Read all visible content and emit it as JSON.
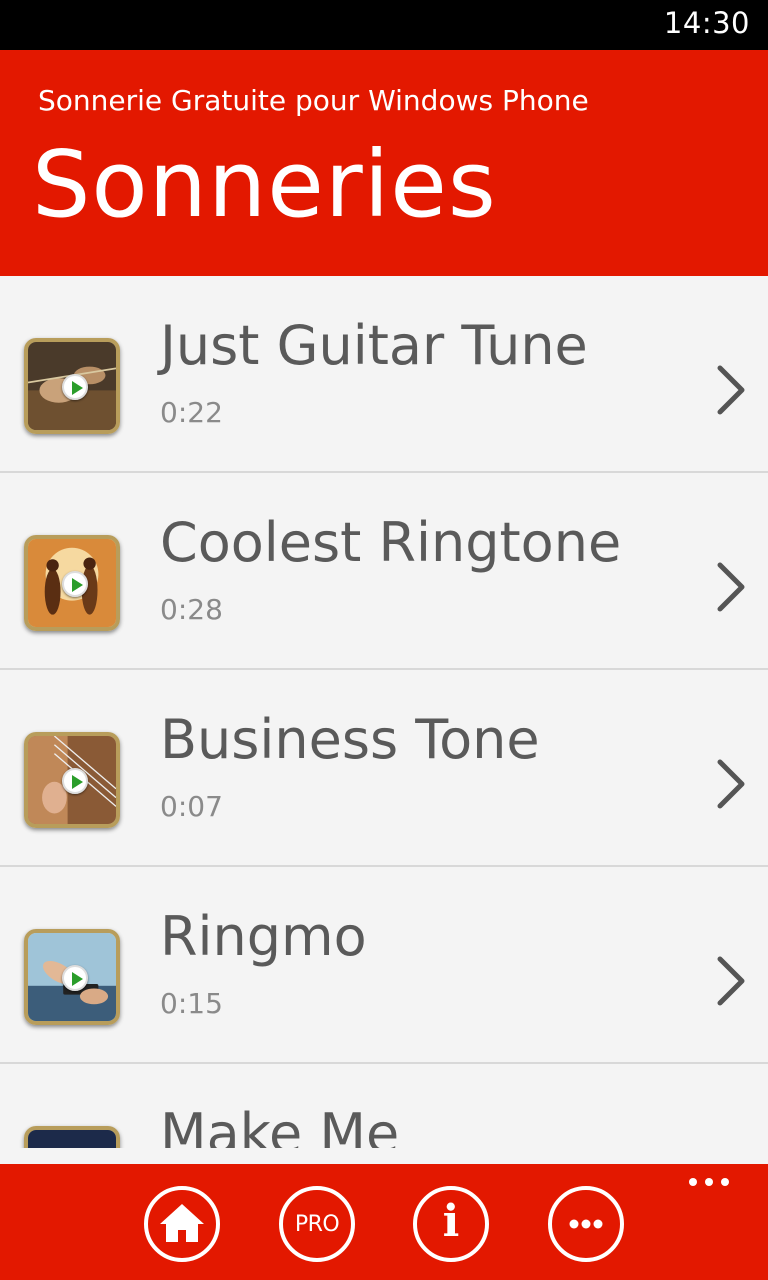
{
  "status_bar": {
    "time": "14:30"
  },
  "header": {
    "app_title": "Sonnerie Gratuite pour Windows Phone",
    "page_title": "Sonneries"
  },
  "ringtones": [
    {
      "title": "Just Guitar Tune",
      "duration": "0:22",
      "thumb_icon": "guitar-photo-icon"
    },
    {
      "title": "Coolest Ringtone",
      "duration": "0:28",
      "thumb_icon": "dancers-photo-icon"
    },
    {
      "title": "Business Tone",
      "duration": "0:07",
      "thumb_icon": "guitar-strings-photo-icon"
    },
    {
      "title": "Ringmo",
      "duration": "0:15",
      "thumb_icon": "phone-in-hands-photo-icon"
    },
    {
      "title": "Make Me",
      "duration": "",
      "thumb_icon": "portrait-photo-icon"
    }
  ],
  "app_bar": {
    "buttons": [
      {
        "name": "home-button",
        "icon": "home-icon"
      },
      {
        "name": "pro-button",
        "icon": "pro-icon",
        "label": "PRO"
      },
      {
        "name": "info-button",
        "icon": "info-icon",
        "label": "i"
      },
      {
        "name": "more-button",
        "icon": "more-icon"
      }
    ],
    "overflow_icon": "ellipsis-icon"
  },
  "colors": {
    "accent": "#e31800",
    "background": "#f4f4f4",
    "title_text": "#5a5a5a",
    "secondary_text": "#8a8a8a"
  }
}
